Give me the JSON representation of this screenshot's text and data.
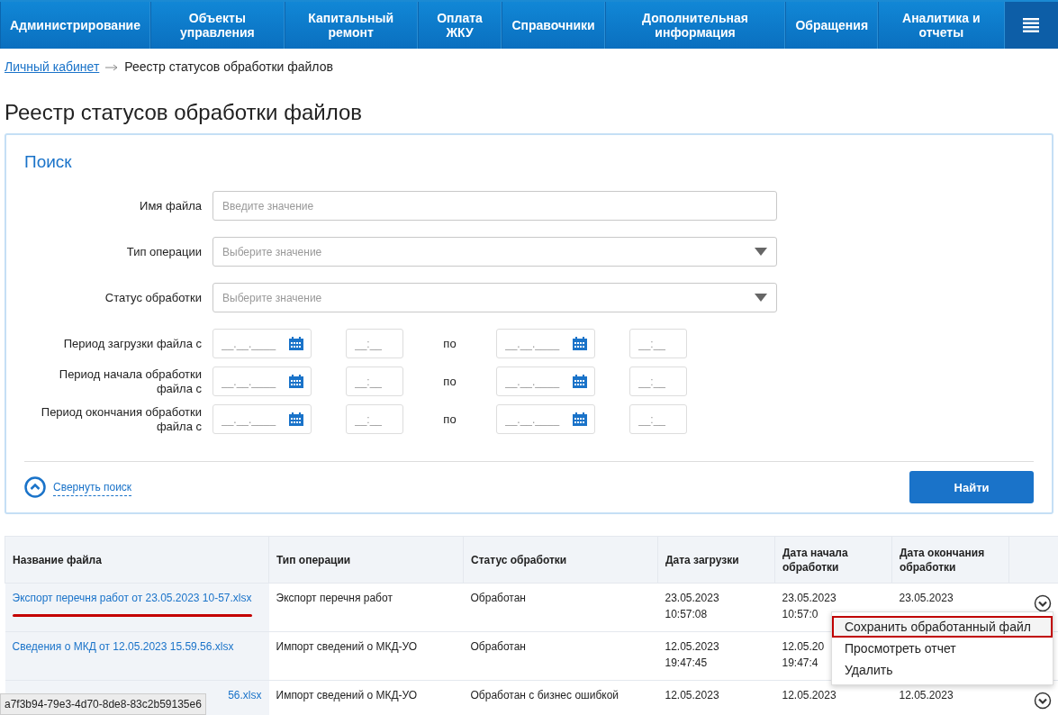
{
  "nav": {
    "items": [
      "Администрирование",
      "Объекты управления",
      "Капитальный ремонт",
      "Оплата ЖКУ",
      "Справочники",
      "Дополнительная информация",
      "Обращения",
      "Аналитика и отчеты"
    ]
  },
  "breadcrumb": {
    "link": "Личный кабинет",
    "current": "Реестр статусов обработки файлов"
  },
  "title": "Реестр статусов обработки файлов",
  "search": {
    "title": "Поиск",
    "fields": [
      {
        "label": "Имя файла",
        "kind": "text",
        "placeholder": "Введите значение"
      },
      {
        "label": "Тип операции",
        "kind": "select",
        "placeholder": "Выберите значение"
      },
      {
        "label": "Статус обработки",
        "kind": "select",
        "placeholder": "Выберите значение"
      }
    ],
    "periods": [
      {
        "label": "Период загрузки файла с",
        "date_placeholder": "__.__.____",
        "time_placeholder": "__:__",
        "to_label": "по",
        "date2_placeholder": "__.__.____",
        "time2_placeholder": "__:__"
      },
      {
        "label": "Период начала обработки файла с",
        "date_placeholder": "__.__.____",
        "time_placeholder": "__:__",
        "to_label": "по",
        "date2_placeholder": "__.__.____",
        "time2_placeholder": "__:__"
      },
      {
        "label": "Период окончания обработки файла с",
        "date_placeholder": "__.__.____",
        "time_placeholder": "__:__",
        "to_label": "по",
        "date2_placeholder": "__.__.____",
        "time2_placeholder": "__:__"
      }
    ],
    "collapse_link": "Свернуть поиск",
    "submit": "Найти"
  },
  "table": {
    "columns": [
      "Название файла",
      "Тип операции",
      "Статус обработки",
      "Дата загрузки",
      "Дата начала обработки",
      "Дата окончания обработки"
    ],
    "rows": [
      {
        "name": "Экспорт перечня работ от 23.05.2023 10-57.xlsx",
        "underlined": true,
        "partial_name": false,
        "operation": "Экспорт перечня работ",
        "status": "Обработан",
        "uploaded": "23.05.2023\n10:57:08",
        "started": "23.05.2023\n10:57:0",
        "finished": "23.05.2023",
        "menu_button": true
      },
      {
        "name": "Сведения о МКД от 12.05.2023 15.59.56.xlsx",
        "underlined": false,
        "partial_name": false,
        "operation": "Импорт сведений о МКД-УО",
        "status": "Обработан",
        "uploaded": "12.05.2023\n19:47:45",
        "started": "12.05.20\n19:47:4",
        "menu_button": false
      },
      {
        "name": "56.xlsx",
        "underlined": false,
        "partial_name": true,
        "operation": "Импорт сведений о МКД-УО",
        "status": "Обработан с бизнес ошибкой",
        "uploaded": "12.05.2023",
        "started": "12.05.2023",
        "finished": "12.05.2023",
        "menu_button": true
      }
    ]
  },
  "context_menu": {
    "items": [
      {
        "label": "Сохранить обработанный файл",
        "selected": true
      },
      {
        "label": "Просмотреть отчет",
        "selected": false
      },
      {
        "label": "Удалить",
        "selected": false
      }
    ]
  },
  "status_url": "a7f3b94-79e3-4d70-8de8-83c2b59135e6"
}
